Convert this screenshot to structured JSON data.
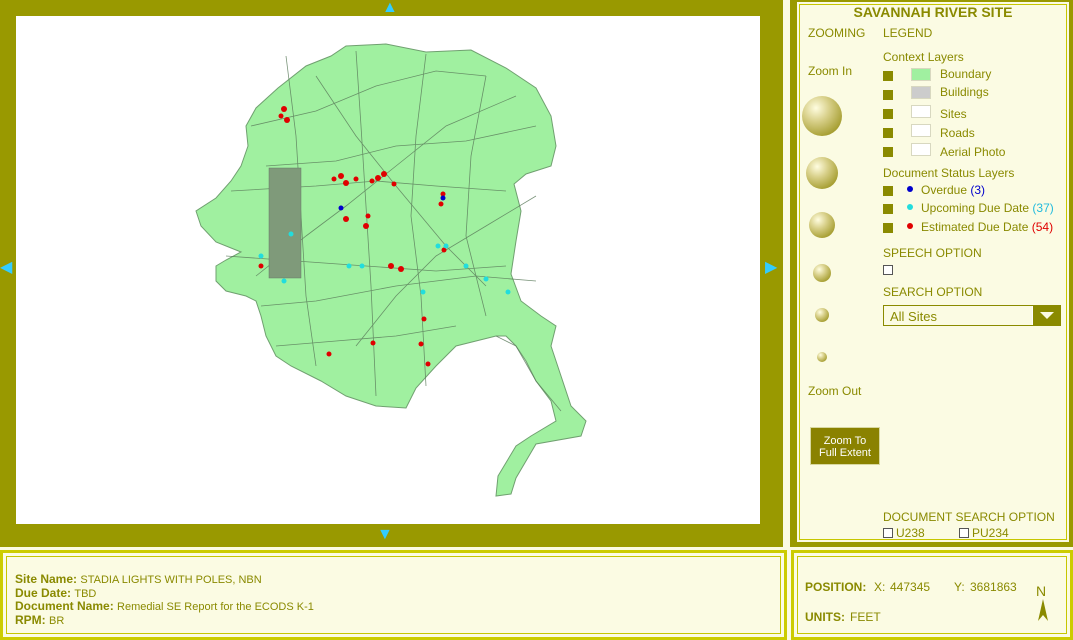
{
  "colors": {
    "frame": "#999900",
    "accent": "#8a8a00",
    "boundary_fill": "#a0f0a0",
    "overdue": "#0000cc",
    "upcoming": "#22dddd",
    "estimated": "#e00000"
  },
  "panel": {
    "title": "SAVANNAH RIVER SITE",
    "zooming": "ZOOMING",
    "zoom_in": "Zoom In",
    "zoom_out": "Zoom Out",
    "zoom_full": [
      "Zoom To",
      "Full Extent"
    ],
    "legend": "LEGEND",
    "context_layers": "Context Layers",
    "context_items": [
      {
        "label": "Boundary",
        "color": "#a0f0a0"
      },
      {
        "label": "Buildings",
        "color": "#cccccc"
      },
      {
        "label": "Sites",
        "color": "#ffffff"
      },
      {
        "label": "Roads",
        "color": "#ffffff"
      },
      {
        "label": "Aerial Photo",
        "color": "#ffffff"
      }
    ],
    "doc_status_layers": "Document Status Layers",
    "status_items": [
      {
        "label": "Overdue",
        "count": "(3)",
        "color": "#0000cc"
      },
      {
        "label": "Upcoming Due Date",
        "count": "(37)",
        "color": "#22dddd"
      },
      {
        "label": "Estimated Due Date",
        "count": "(54)",
        "color": "#e00000"
      }
    ],
    "speech_option": "SPEECH OPTION",
    "search_option": "SEARCH OPTION",
    "search_value": "All Sites",
    "doc_search_option": "DOCUMENT SEARCH OPTION",
    "doc_search_items": [
      "U238",
      "PU234"
    ]
  },
  "info": {
    "site_name_label": "Site Name:",
    "site_name": "STADIA LIGHTS WITH POLES, NBN",
    "due_date_label": "Due Date:",
    "due_date": "TBD",
    "document_name_label": "Document Name:",
    "document_name": "Remedial SE Report for the ECODS K-1",
    "rpm_label": "RPM:",
    "rpm": "BR"
  },
  "position": {
    "label": "POSITION:",
    "x_label": "X:",
    "x": "447345",
    "y_label": "Y:",
    "y": "3681863",
    "units_label": "UNITS:",
    "units": "FEET",
    "north": "N"
  },
  "map": {
    "pan_glyph": {
      "up": "▲",
      "down": "▼",
      "left": "◀",
      "right": "▶"
    }
  }
}
